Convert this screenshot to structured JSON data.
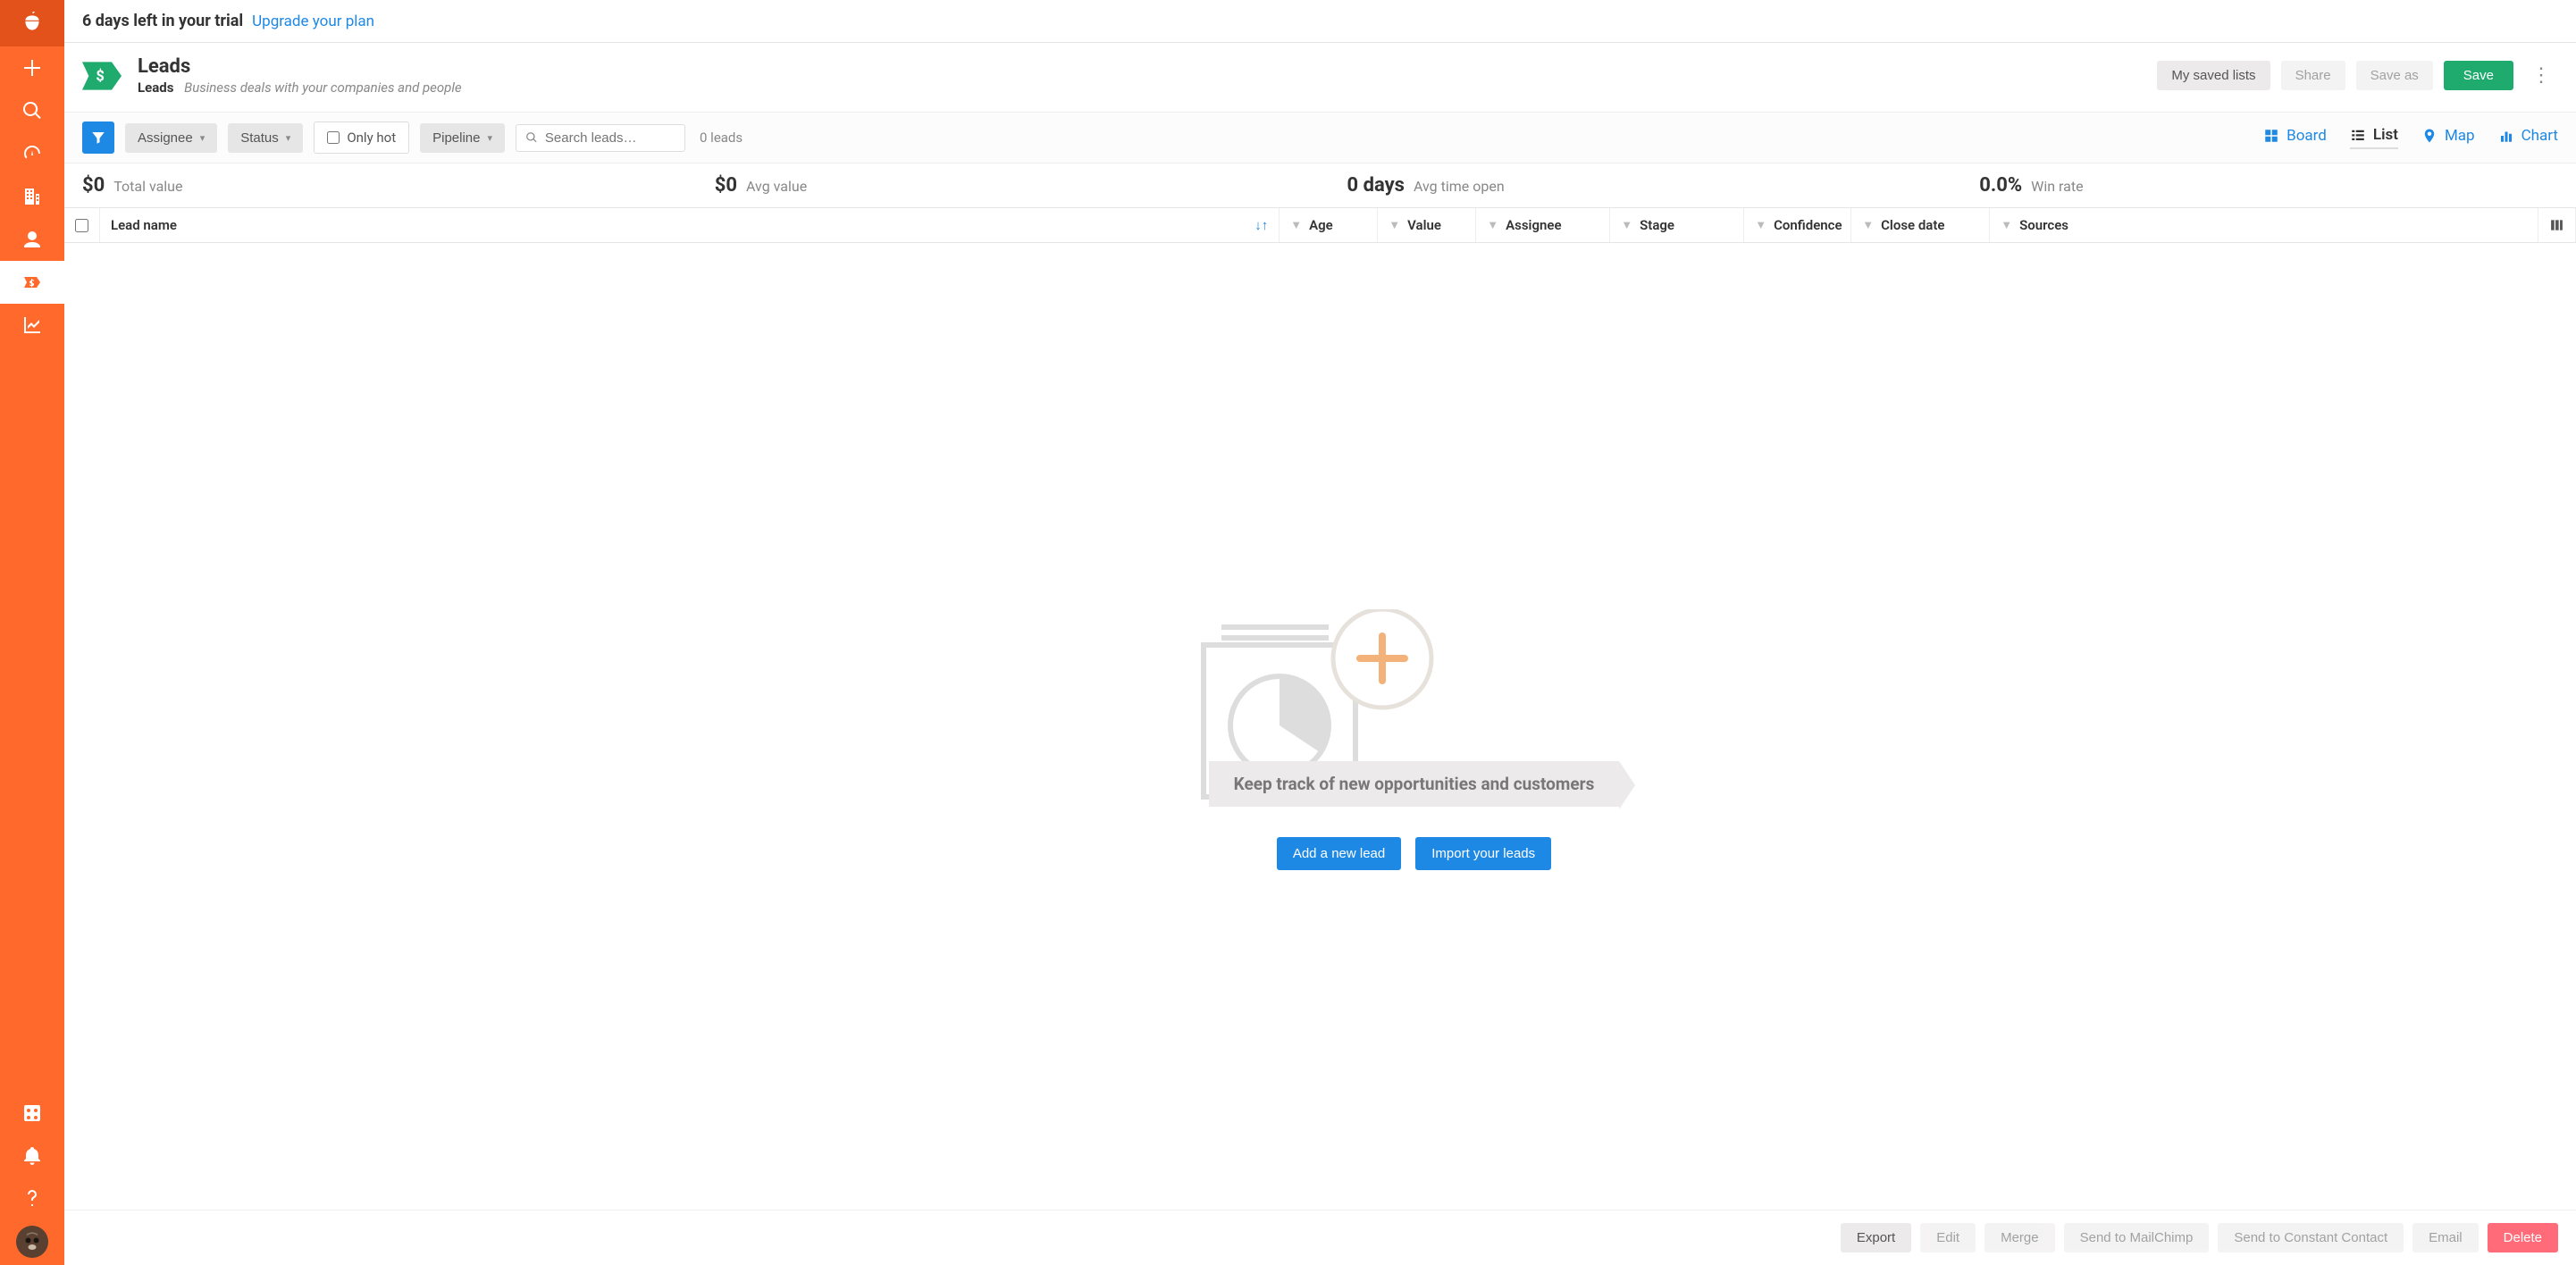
{
  "trial": {
    "text": "6 days left in your trial",
    "upgrade_label": "Upgrade your plan"
  },
  "page": {
    "title": "Leads",
    "subtitle_bold": "Leads",
    "subtitle_desc": "Business deals with your companies and people"
  },
  "header_actions": {
    "my_saved_lists": "My saved lists",
    "share": "Share",
    "save_as": "Save as",
    "save": "Save"
  },
  "filters": {
    "assignee": "Assignee",
    "status": "Status",
    "only_hot": "Only hot",
    "pipeline": "Pipeline",
    "search_placeholder": "Search leads…",
    "lead_count": "0 leads"
  },
  "views": {
    "board": "Board",
    "list": "List",
    "map": "Map",
    "chart": "Chart",
    "active": "list"
  },
  "stats": {
    "total_value": {
      "value": "$0",
      "label": "Total value"
    },
    "avg_value": {
      "value": "$0",
      "label": "Avg value"
    },
    "avg_time_open": {
      "value": "0 days",
      "label": "Avg time open"
    },
    "win_rate": {
      "value": "0.0%",
      "label": "Win rate"
    }
  },
  "columns": {
    "lead_name": "Lead name",
    "age": "Age",
    "value": "Value",
    "assignee": "Assignee",
    "stage": "Stage",
    "confidence": "Confidence",
    "close_date": "Close date",
    "sources": "Sources"
  },
  "empty": {
    "message": "Keep track of new opportunities and customers",
    "add_lead_label": "Add a new lead",
    "import_label": "Import your leads"
  },
  "footer": {
    "export": "Export",
    "edit": "Edit",
    "merge": "Merge",
    "send_mailchimp": "Send to MailChimp",
    "send_cc": "Send to Constant Contact",
    "email": "Email",
    "delete": "Delete"
  },
  "icons": {
    "logo": "acorn-icon",
    "add": "plus-icon",
    "search": "magnifier-icon",
    "dashboard": "gauge-icon",
    "companies": "building-icon",
    "people": "person-icon",
    "leads": "tag-dollar-icon",
    "reports": "chart-icon",
    "apps": "dice-icon",
    "notifications": "bell-icon",
    "help": "question-icon"
  }
}
